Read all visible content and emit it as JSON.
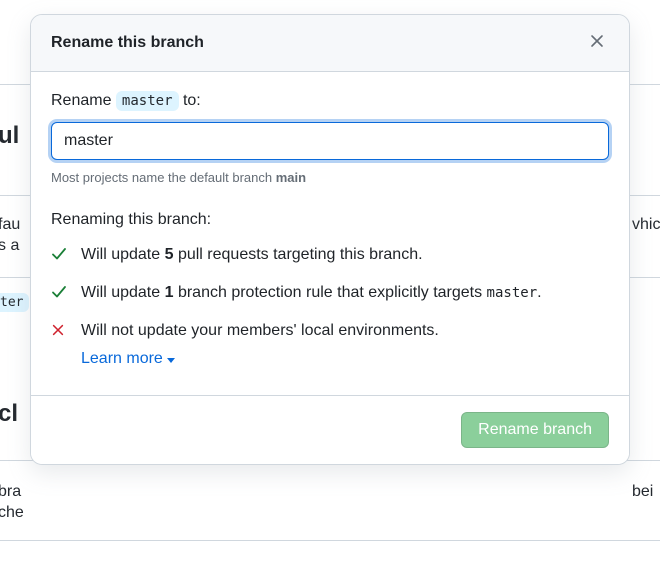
{
  "modal": {
    "title": "Rename this branch",
    "label_prefix": "Rename ",
    "current_branch": "master",
    "label_suffix": " to:",
    "input_value": "master",
    "hint_prefix": "Most projects name the default branch ",
    "hint_bold": "main",
    "effects_heading": "Renaming this branch:",
    "items": [
      {
        "kind": "check",
        "pre": "Will update ",
        "bold": "5",
        "post": " pull requests targeting this branch."
      },
      {
        "kind": "check",
        "pre": "Will update ",
        "bold": "1",
        "post": " branch protection rule that explicitly targets ",
        "mono": "master",
        "tail": "."
      },
      {
        "kind": "x",
        "pre": "Will not update your members' local environments."
      }
    ],
    "learn_more": "Learn more",
    "submit_label": "Rename branch"
  },
  "background": {
    "t1": "ul",
    "t2": "fau",
    "t3": "s a",
    "t4": "vhic",
    "t5": "ter",
    "t6": "cl",
    "t7": "bra",
    "t8": "che",
    "t9": "bei"
  }
}
